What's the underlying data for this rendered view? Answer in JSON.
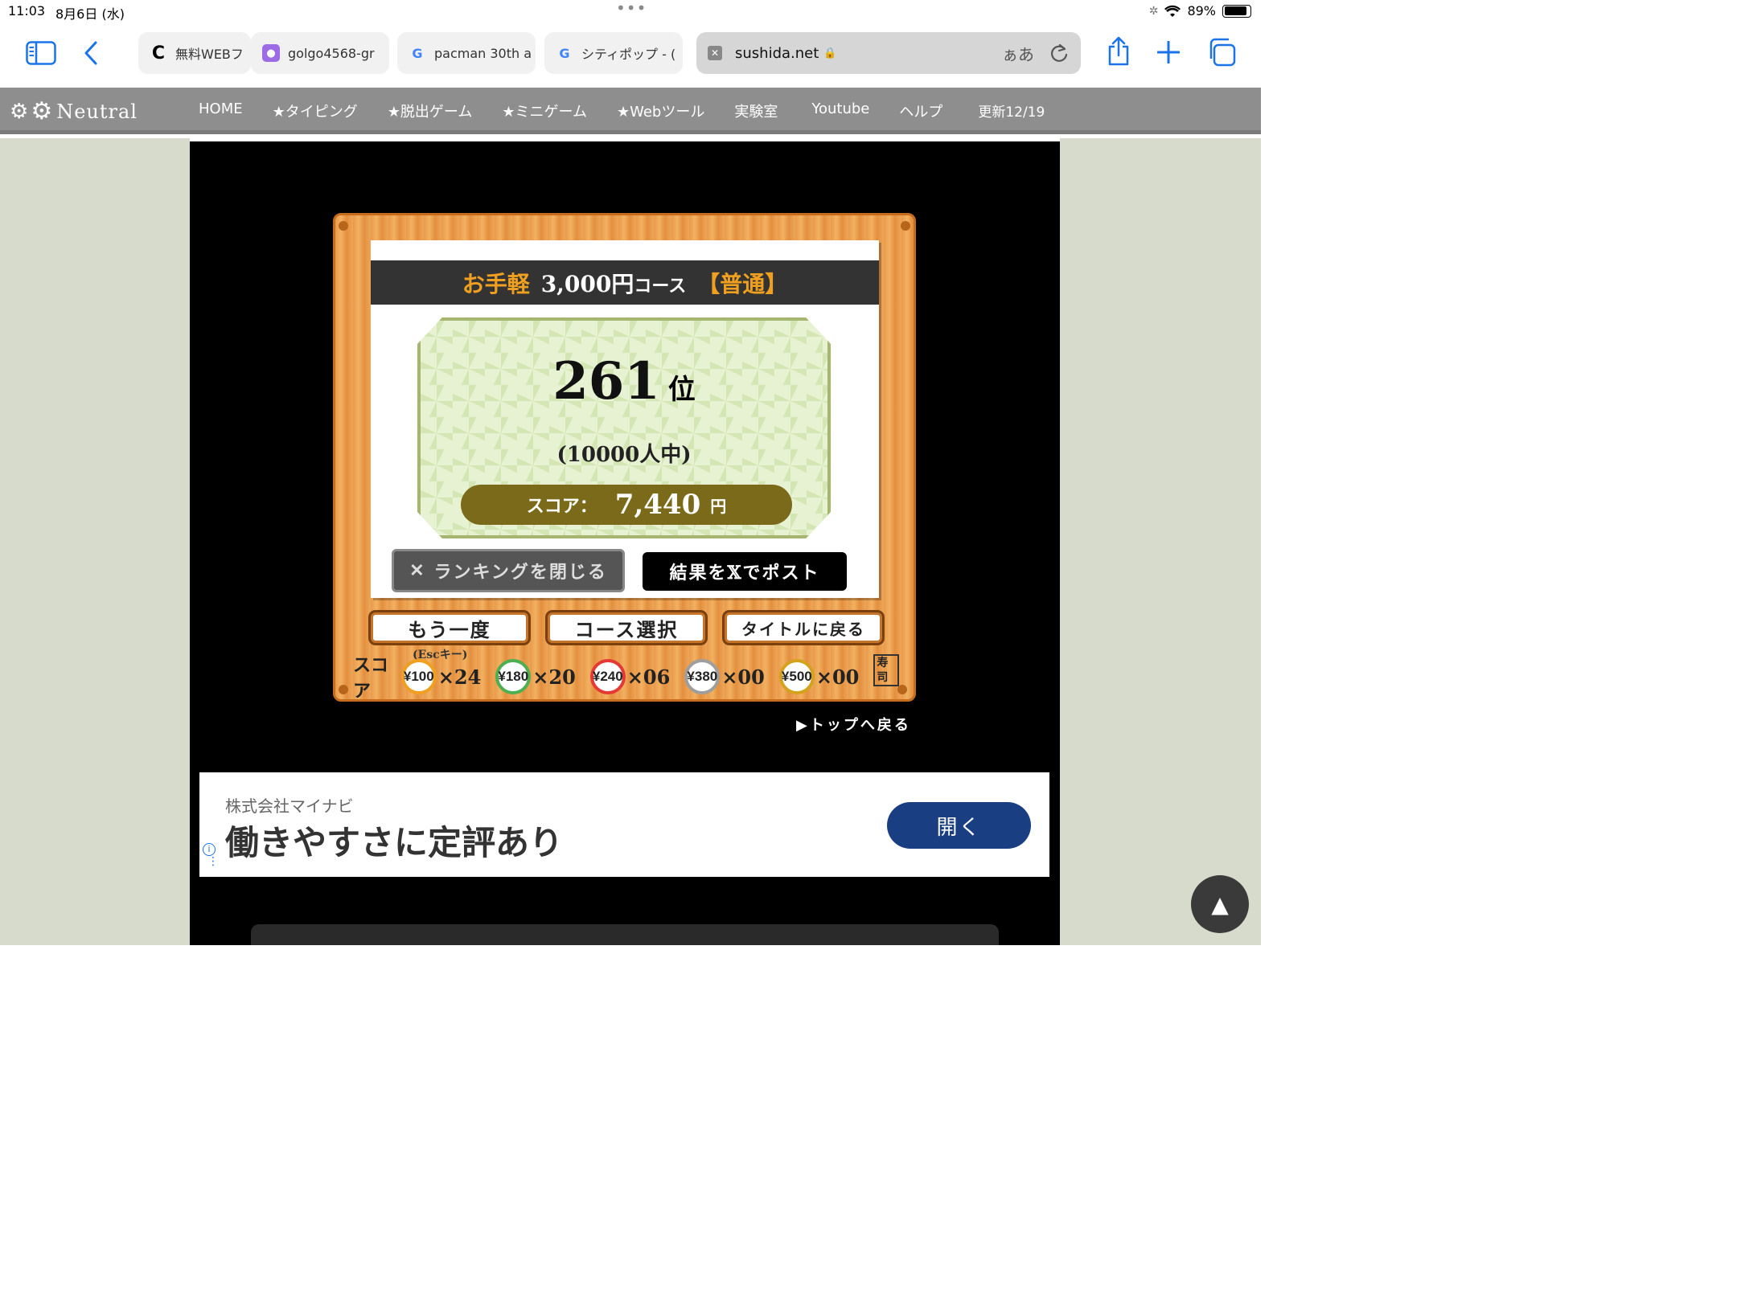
{
  "status": {
    "time": "11:03",
    "date": "8月6日 (水)",
    "battery": "89%"
  },
  "tabs": [
    {
      "label": "無料WEBフ",
      "fav": "C"
    },
    {
      "label": "golgo4568-gr",
      "fav": "💡"
    },
    {
      "label": "pacman 30th a",
      "fav": "G"
    },
    {
      "label": "シティポップ - (",
      "fav": "G"
    },
    {
      "label": "sushida.net",
      "fav": "✕",
      "url_hint": "ぁあ"
    }
  ],
  "nav": {
    "logo": "Neutral",
    "items": [
      "HOME",
      "★タイピング",
      "★脱出ゲーム",
      "★ミニゲーム",
      "★Webツール",
      "実験室",
      "Youtube",
      "ヘルプ",
      "更新12/19"
    ]
  },
  "game": {
    "course_a": "お手軽",
    "course_b": "3,000円",
    "course_c": "コース",
    "course_d": "【普通】",
    "rank": "261",
    "rank_unit": "位",
    "total": "(10000人中)",
    "score_label": "スコア：",
    "score": "7,440",
    "score_unit": "円",
    "close_ranking": "ランキングを閉じる",
    "post_result": "結果を𝕏でポスト",
    "retry": "もう一度",
    "retry_hint": "(Escキー)",
    "course_select": "コース選択",
    "back_title": "タイトルに戻る",
    "chips_label": "スコア",
    "chips": [
      {
        "value": "¥100",
        "count": "×24",
        "color": "#f0a020"
      },
      {
        "value": "¥180",
        "count": "×20",
        "color": "#4caf50"
      },
      {
        "value": "¥240",
        "count": "×06",
        "color": "#e53935"
      },
      {
        "value": "¥380",
        "count": "×00",
        "color": "#9e9e9e"
      },
      {
        "value": "¥500",
        "count": "×00",
        "color": "#d4a21c"
      }
    ],
    "back_top": "▶トップへ戻る"
  },
  "ad": {
    "company": "株式会社マイナビ",
    "headline": "働きやすさに定評あり",
    "button": "開く"
  },
  "page_top": "▲"
}
